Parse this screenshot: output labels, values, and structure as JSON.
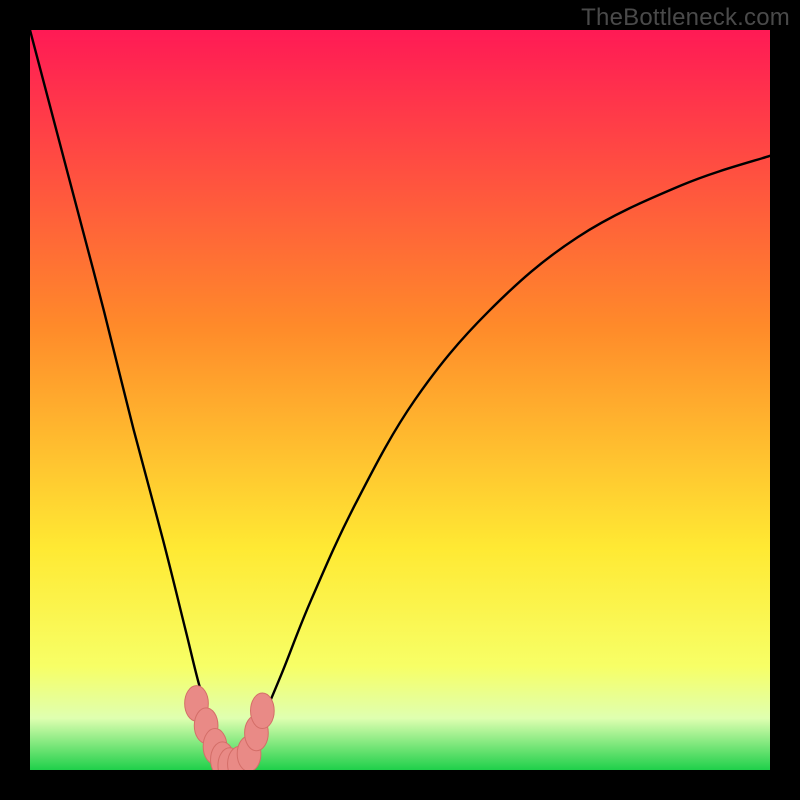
{
  "watermark": "TheBottleneck.com",
  "colors": {
    "bg_black": "#000000",
    "grad_top": "#ff1a55",
    "grad_mid1": "#ff8a2a",
    "grad_mid2": "#ffe933",
    "grad_low": "#f7ff66",
    "grad_pale": "#dfffb0",
    "grad_green": "#1fd04a",
    "curve_stroke": "#000000",
    "marker_fill": "#e98a86",
    "marker_stroke": "#d46e68"
  },
  "chart_data": {
    "type": "line",
    "title": "",
    "xlabel": "",
    "ylabel": "",
    "xlim": [
      0,
      100
    ],
    "ylim": [
      0,
      100
    ],
    "note": "Bottleneck-style plot. x is a normalized component axis (0–100). y is mismatch percentage (0 = perfect match, 100 = full bottleneck). The curve dips to ~0 near x≈27 indicating the balanced point; it rises steeply on both sides. Background gradient encodes y from green (good, y≈0) at the bottom to red (bad, y≈100) at the top.",
    "series": [
      {
        "name": "bottleneck-curve",
        "x": [
          0,
          5,
          10,
          14,
          18,
          21,
          23,
          25,
          26,
          27,
          28,
          29,
          31,
          34,
          38,
          44,
          52,
          62,
          74,
          88,
          100
        ],
        "y": [
          100,
          81,
          62,
          46,
          31,
          19,
          11,
          5,
          2,
          0.5,
          0.5,
          2,
          6,
          13,
          23,
          36,
          50,
          62,
          72,
          79,
          83
        ]
      }
    ],
    "markers": {
      "name": "highlight-cluster",
      "points": [
        {
          "x": 22.5,
          "y": 9
        },
        {
          "x": 23.8,
          "y": 6
        },
        {
          "x": 25.0,
          "y": 3.2
        },
        {
          "x": 26.0,
          "y": 1.4
        },
        {
          "x": 27.0,
          "y": 0.6
        },
        {
          "x": 28.3,
          "y": 0.8
        },
        {
          "x": 29.6,
          "y": 2.2
        },
        {
          "x": 30.6,
          "y": 5.0
        },
        {
          "x": 31.4,
          "y": 8.0
        }
      ],
      "rx": 1.6,
      "ry": 2.4
    },
    "gradient_stops": [
      {
        "offset": 0.0,
        "key": "grad_top"
      },
      {
        "offset": 0.4,
        "key": "grad_mid1"
      },
      {
        "offset": 0.7,
        "key": "grad_mid2"
      },
      {
        "offset": 0.86,
        "key": "grad_low"
      },
      {
        "offset": 0.93,
        "key": "grad_pale"
      },
      {
        "offset": 1.0,
        "key": "grad_green"
      }
    ]
  }
}
